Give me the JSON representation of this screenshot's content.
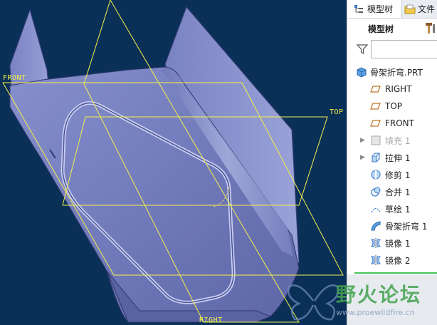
{
  "viewport": {
    "datum_labels": {
      "front": "FRONT",
      "top": "TOP",
      "right": "RIGHT"
    },
    "colors": {
      "background": "#0b3058",
      "part_fill": "#7d86c4",
      "datum_plane": "#f2f24a"
    }
  },
  "panel": {
    "tabs": [
      {
        "label": "模型树",
        "icon": "model-tree-tab-icon",
        "active": true
      },
      {
        "label": "文件",
        "icon": "folder-tab-icon",
        "active": false
      }
    ],
    "toolbar": {
      "title": "模型树",
      "icon": "hammer-settings-icon"
    },
    "filter": {
      "value": "",
      "placeholder": "",
      "icon": "filter-funnel-icon"
    },
    "tree": {
      "root": {
        "label": "骨架折弯.PRT",
        "icon": "part-icon"
      },
      "items": [
        {
          "label": "RIGHT",
          "icon": "datum-plane-icon",
          "expandable": false,
          "dim": false
        },
        {
          "label": "TOP",
          "icon": "datum-plane-icon",
          "expandable": false,
          "dim": false
        },
        {
          "label": "FRONT",
          "icon": "datum-plane-icon",
          "expandable": false,
          "dim": false
        },
        {
          "label": "填充 1",
          "icon": "fill-icon",
          "expandable": true,
          "dim": true
        },
        {
          "label": "拉伸 1",
          "icon": "extrude-icon",
          "expandable": true,
          "dim": false
        },
        {
          "label": "修剪 1",
          "icon": "trim-icon",
          "expandable": false,
          "dim": false
        },
        {
          "label": "合并 1",
          "icon": "merge-icon",
          "expandable": false,
          "dim": false
        },
        {
          "label": "草绘 1",
          "icon": "sketch-icon",
          "expandable": false,
          "dim": false
        },
        {
          "label": "骨架折弯 1",
          "icon": "spinal-bend-icon",
          "expandable": false,
          "dim": false
        },
        {
          "label": "镜像 1",
          "icon": "mirror-icon",
          "expandable": false,
          "dim": false
        },
        {
          "label": "镜像 2",
          "icon": "mirror-icon",
          "expandable": false,
          "dim": false
        }
      ]
    }
  },
  "watermark": {
    "title": "野火论坛",
    "url": "www.proewildfire.cn"
  }
}
